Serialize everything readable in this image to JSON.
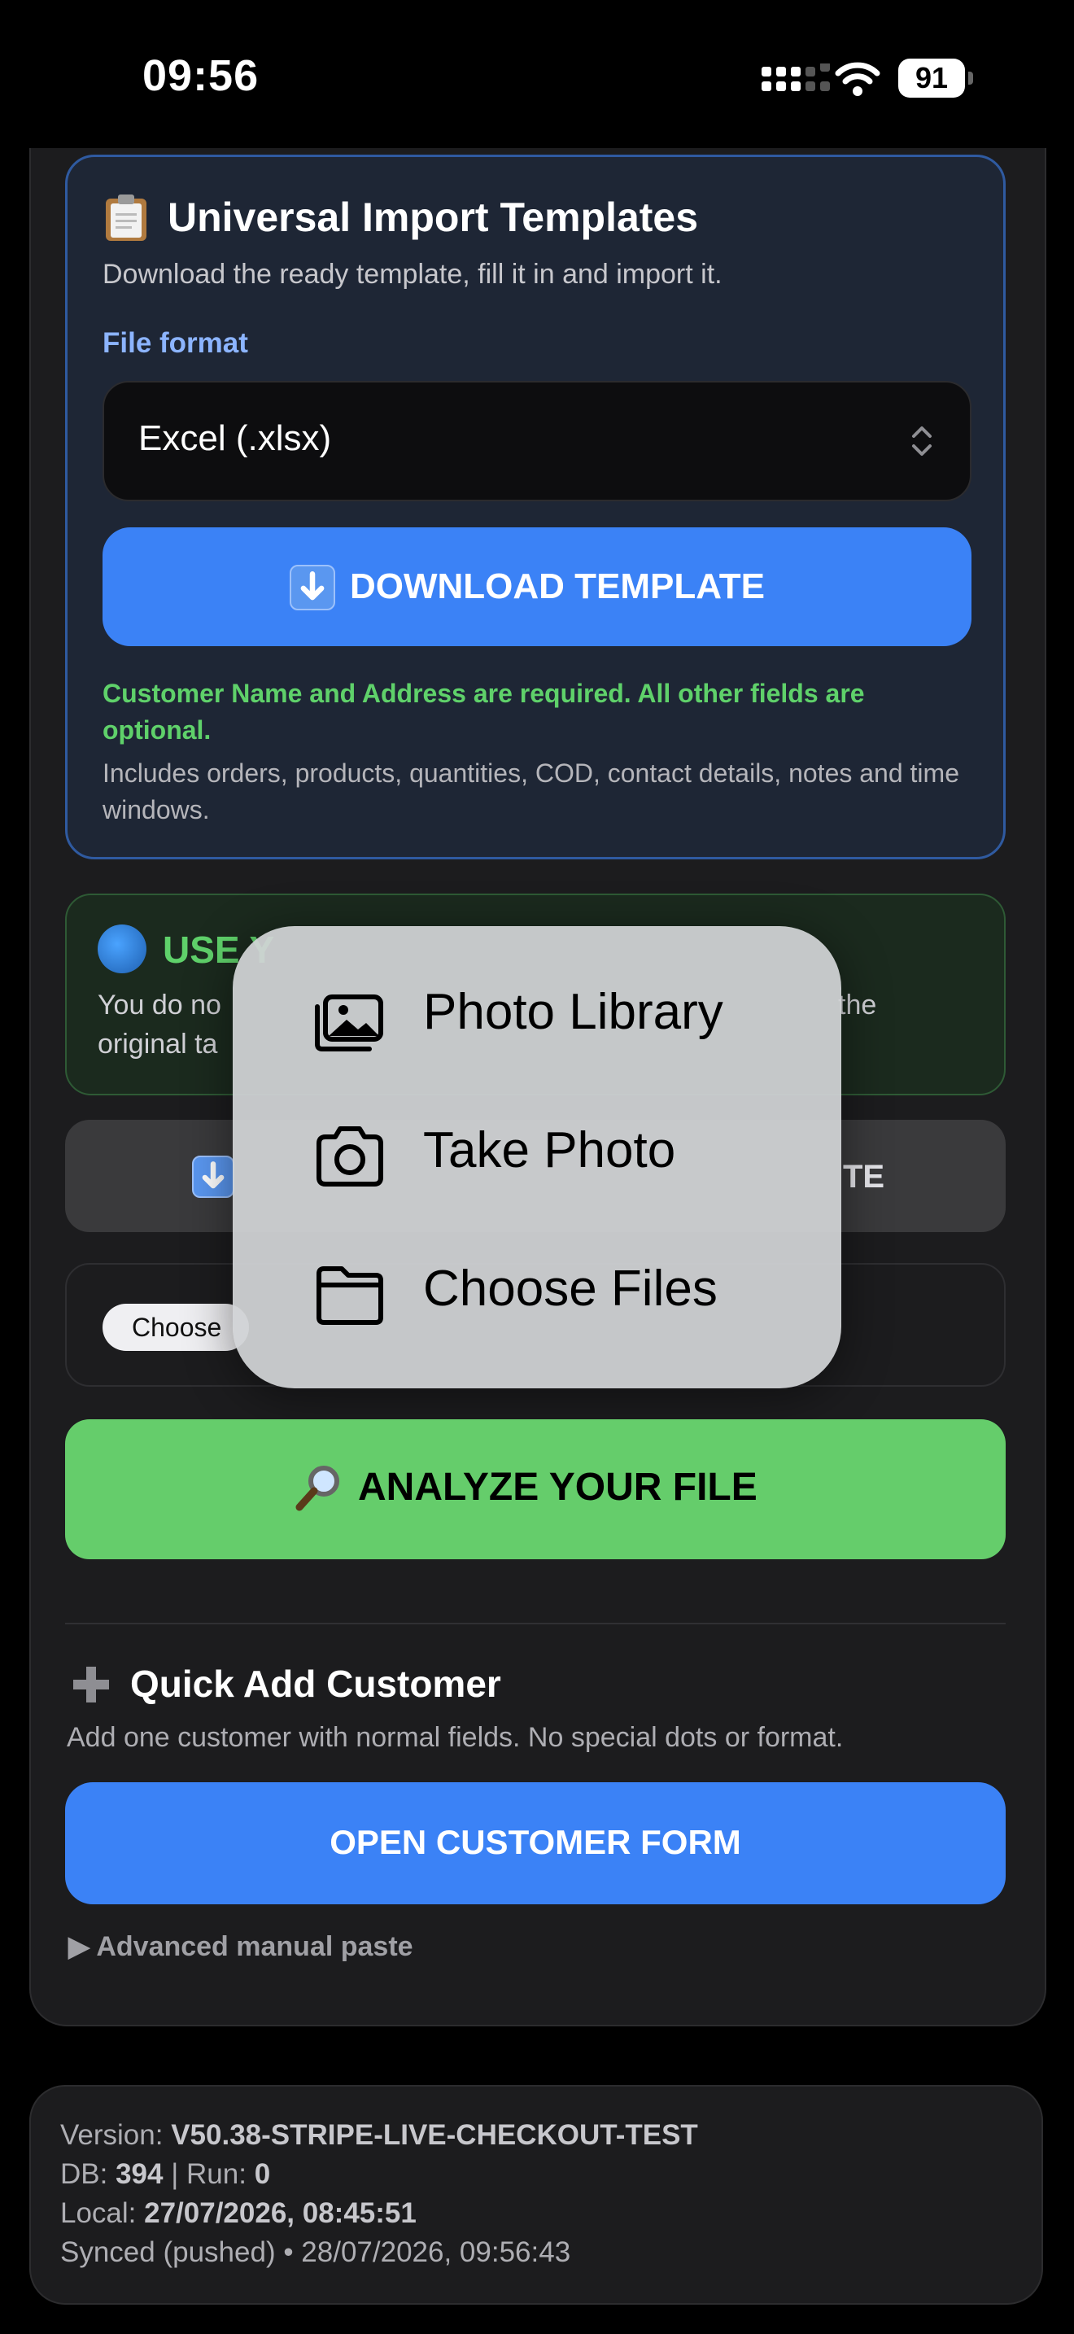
{
  "status_bar": {
    "time": "09:56",
    "battery": "91"
  },
  "template_card": {
    "title": "Universal Import Templates",
    "description": "Download the ready template, fill it in and import it.",
    "format_label": "File format",
    "format_value": "Excel (.xlsx)",
    "download_label": "DOWNLOAD TEMPLATE",
    "required_note": "Customer Name and Address are required. All other fields are optional.",
    "includes_note": "Includes orders, products, quantities, COD, contact details, notes and time windows."
  },
  "use_card": {
    "title_visible": "USE Y",
    "text_left": "You do no",
    "text_right": "the",
    "text_line2": "original ta"
  },
  "gray_button": {
    "label_visible": "TE"
  },
  "file_input": {
    "button_label": "Choose"
  },
  "file_menu": {
    "items": [
      {
        "label": "Photo Library",
        "icon": "photo-library-icon"
      },
      {
        "label": "Take Photo",
        "icon": "camera-icon"
      },
      {
        "label": "Choose Files",
        "icon": "folder-icon"
      }
    ]
  },
  "analyze_button": {
    "label": "ANALYZE YOUR FILE"
  },
  "quick_add": {
    "title": "Quick Add Customer",
    "description": "Add one customer with normal fields. No special dots or format.",
    "button_label": "OPEN CUSTOMER FORM",
    "advanced_label": "▶ Advanced manual paste"
  },
  "version_info": {
    "version_key": "Version: ",
    "version_value": "V50.38-STRIPE-LIVE-CHECKOUT-TEST",
    "db_key": "DB: ",
    "db_value": "394",
    "run_key": " | Run: ",
    "run_value": "0",
    "local_key": "Local: ",
    "local_value": "27/07/2026, 08:45:51",
    "synced_text": "Synced (pushed) • 28/07/2026, 09:56:43"
  },
  "colors": {
    "primary_blue": "#3b82f6",
    "success_green": "#65cd6b",
    "required_green": "#5fd16a",
    "label_blue": "#8cb4ff"
  }
}
